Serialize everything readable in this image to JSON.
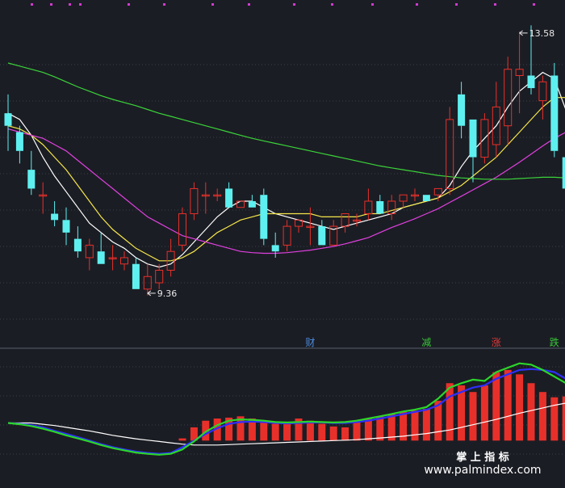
{
  "chart_data": [
    {
      "type": "candlestick",
      "title": "",
      "ylim": [
        8.6,
        13.9
      ],
      "grid": true,
      "candles": [
        [
          12.2,
          12.5,
          11.6,
          12.0
        ],
        [
          11.9,
          12.0,
          11.4,
          11.6
        ],
        [
          11.3,
          11.6,
          10.9,
          11.0
        ],
        [
          10.9,
          11.1,
          10.6,
          10.9
        ],
        [
          10.6,
          10.8,
          10.4,
          10.5
        ],
        [
          10.5,
          10.7,
          10.1,
          10.3
        ],
        [
          10.2,
          10.4,
          9.9,
          10.0
        ],
        [
          9.9,
          10.2,
          9.7,
          10.1
        ],
        [
          10.0,
          10.3,
          9.8,
          9.8
        ],
        [
          9.9,
          10.1,
          9.7,
          9.9
        ],
        [
          9.8,
          10.0,
          9.7,
          9.9
        ],
        [
          9.8,
          9.9,
          9.4,
          9.4
        ],
        [
          9.4,
          9.8,
          9.3,
          9.6
        ],
        [
          9.5,
          9.8,
          9.4,
          9.7
        ],
        [
          9.7,
          10.2,
          9.6,
          10.0
        ],
        [
          10.1,
          10.7,
          10.0,
          10.6
        ],
        [
          10.6,
          11.1,
          10.5,
          11.0
        ],
        [
          10.9,
          11.1,
          10.6,
          10.9
        ],
        [
          10.9,
          11.0,
          10.8,
          10.9
        ],
        [
          11.0,
          11.1,
          10.7,
          10.7
        ],
        [
          10.7,
          10.8,
          10.7,
          10.8
        ],
        [
          10.8,
          10.9,
          10.7,
          10.7
        ],
        [
          10.9,
          11.0,
          10.1,
          10.2
        ],
        [
          10.1,
          10.3,
          9.9,
          10.0
        ],
        [
          10.1,
          10.5,
          10.0,
          10.4
        ],
        [
          10.4,
          10.5,
          10.3,
          10.5
        ],
        [
          10.4,
          10.7,
          10.1,
          10.4
        ],
        [
          10.4,
          10.5,
          10.1,
          10.1
        ],
        [
          10.1,
          10.5,
          10.1,
          10.4
        ],
        [
          10.4,
          10.6,
          10.3,
          10.6
        ],
        [
          10.5,
          10.6,
          10.4,
          10.5
        ],
        [
          10.6,
          11.0,
          10.5,
          10.8
        ],
        [
          10.8,
          10.9,
          10.6,
          10.6
        ],
        [
          10.6,
          10.9,
          10.5,
          10.8
        ],
        [
          10.8,
          10.9,
          10.7,
          10.9
        ],
        [
          10.9,
          11.0,
          10.8,
          10.9
        ],
        [
          10.9,
          10.9,
          10.8,
          10.8
        ],
        [
          10.9,
          11.0,
          10.8,
          11.0
        ],
        [
          11.0,
          12.3,
          10.9,
          12.1
        ],
        [
          12.5,
          12.7,
          11.8,
          12.0
        ],
        [
          12.1,
          12.1,
          11.1,
          11.5
        ],
        [
          11.5,
          12.2,
          11.4,
          12.1
        ],
        [
          11.7,
          12.7,
          11.5,
          12.3
        ],
        [
          12.0,
          13.1,
          11.7,
          12.9
        ],
        [
          12.8,
          13.5,
          12.2,
          12.9
        ],
        [
          12.8,
          13.6,
          12.5,
          12.6
        ],
        [
          12.4,
          12.8,
          12.1,
          12.7
        ],
        [
          12.8,
          13.0,
          11.5,
          11.6
        ],
        [
          11.5,
          11.7,
          10.7,
          11.0
        ],
        [
          10.9,
          11.9,
          10.8,
          11.8
        ]
      ],
      "ma_lines": [
        {
          "color": "#ffffff",
          "values": [
            12.2,
            12.1,
            11.85,
            11.5,
            11.2,
            10.95,
            10.7,
            10.45,
            10.3,
            10.15,
            10.05,
            9.9,
            9.8,
            9.75,
            9.8,
            9.95,
            10.15,
            10.35,
            10.55,
            10.7,
            10.8,
            10.8,
            10.7,
            10.6,
            10.55,
            10.5,
            10.45,
            10.4,
            10.35,
            10.4,
            10.45,
            10.5,
            10.55,
            10.6,
            10.7,
            10.75,
            10.8,
            10.85,
            11.05,
            11.35,
            11.6,
            11.8,
            12.0,
            12.3,
            12.55,
            12.7,
            12.85,
            12.75,
            12.25,
            12.15
          ]
        },
        {
          "color": "#f5e64a",
          "values": [
            12.0,
            11.95,
            11.85,
            11.7,
            11.5,
            11.3,
            11.05,
            10.8,
            10.55,
            10.35,
            10.2,
            10.05,
            9.95,
            9.85,
            9.85,
            9.9,
            10.0,
            10.15,
            10.3,
            10.4,
            10.5,
            10.55,
            10.6,
            10.6,
            10.6,
            10.6,
            10.6,
            10.55,
            10.55,
            10.55,
            10.55,
            10.6,
            10.6,
            10.65,
            10.7,
            10.75,
            10.8,
            10.85,
            10.95,
            11.05,
            11.2,
            11.35,
            11.5,
            11.7,
            11.9,
            12.1,
            12.3,
            12.45,
            12.45,
            12.5
          ]
        },
        {
          "color": "#e040e0",
          "values": [
            11.95,
            11.9,
            11.85,
            11.8,
            11.7,
            11.6,
            11.45,
            11.3,
            11.15,
            11.0,
            10.85,
            10.7,
            10.55,
            10.45,
            10.35,
            10.25,
            10.2,
            10.15,
            10.1,
            10.05,
            10.0,
            9.98,
            9.97,
            9.97,
            9.98,
            10.0,
            10.02,
            10.05,
            10.08,
            10.12,
            10.17,
            10.22,
            10.3,
            10.38,
            10.45,
            10.52,
            10.6,
            10.68,
            10.78,
            10.88,
            10.98,
            11.08,
            11.18,
            11.3,
            11.42,
            11.55,
            11.68,
            11.8,
            11.9,
            11.95
          ]
        },
        {
          "color": "#3ad43a",
          "values": [
            13.0,
            12.95,
            12.9,
            12.85,
            12.78,
            12.7,
            12.62,
            12.55,
            12.48,
            12.42,
            12.37,
            12.32,
            12.26,
            12.2,
            12.15,
            12.1,
            12.05,
            12.0,
            11.95,
            11.9,
            11.85,
            11.8,
            11.76,
            11.72,
            11.68,
            11.64,
            11.6,
            11.56,
            11.52,
            11.48,
            11.44,
            11.4,
            11.36,
            11.33,
            11.3,
            11.27,
            11.24,
            11.21,
            11.19,
            11.17,
            11.16,
            11.15,
            11.15,
            11.15,
            11.16,
            11.17,
            11.18,
            11.18,
            11.17,
            11.15
          ]
        }
      ],
      "annotations": [
        {
          "text": "13.58",
          "x_index": 44,
          "value": 13.58
        },
        {
          "text": "9.36",
          "x_index": 12,
          "value": 9.36
        }
      ],
      "event_tags": [
        {
          "text": "财",
          "x_index": 26,
          "color": "#4d8de0"
        },
        {
          "text": "减",
          "x_index": 36,
          "color": "#39c639"
        },
        {
          "text": "涨",
          "x_index": 42,
          "color": "#e03a3a"
        },
        {
          "text": "跌",
          "x_index": 47,
          "color": "#39c639"
        }
      ]
    },
    {
      "type": "bar",
      "title": "",
      "ylim": [
        -1.0,
        2.0
      ],
      "grid": true,
      "values": [
        0,
        0,
        0,
        0,
        0,
        0,
        0,
        0,
        0,
        0,
        0,
        0,
        0,
        0,
        0,
        0.05,
        0.3,
        0.45,
        0.5,
        0.52,
        0.55,
        0.5,
        0.42,
        0.38,
        0.4,
        0.5,
        0.45,
        0.38,
        0.32,
        0.3,
        0.42,
        0.5,
        0.55,
        0.6,
        0.65,
        0.68,
        0.72,
        0.9,
        1.3,
        1.25,
        1.1,
        1.25,
        1.55,
        1.6,
        1.5,
        1.3,
        1.1,
        0.98,
        1.0,
        1.0
      ],
      "lines": [
        {
          "color": "#ffffff",
          "values": [
            0.4,
            0.4,
            0.4,
            0.37,
            0.34,
            0.3,
            0.26,
            0.22,
            0.17,
            0.12,
            0.08,
            0.04,
            0.01,
            -0.02,
            -0.05,
            -0.08,
            -0.1,
            -0.1,
            -0.1,
            -0.09,
            -0.08,
            -0.07,
            -0.06,
            -0.05,
            -0.04,
            -0.03,
            -0.02,
            -0.01,
            0.0,
            0.01,
            0.02,
            0.04,
            0.06,
            0.08,
            0.1,
            0.13,
            0.16,
            0.2,
            0.24,
            0.3,
            0.36,
            0.42,
            0.48,
            0.55,
            0.62,
            0.68,
            0.74,
            0.8,
            0.85,
            0.9
          ]
        },
        {
          "color": "#2e2eff",
          "values": [
            0.4,
            0.38,
            0.35,
            0.3,
            0.22,
            0.15,
            0.08,
            0.0,
            -0.08,
            -0.15,
            -0.2,
            -0.25,
            -0.28,
            -0.3,
            -0.28,
            -0.15,
            0.0,
            0.15,
            0.28,
            0.38,
            0.42,
            0.43,
            0.42,
            0.4,
            0.39,
            0.4,
            0.41,
            0.41,
            0.4,
            0.4,
            0.42,
            0.45,
            0.5,
            0.55,
            0.6,
            0.65,
            0.7,
            0.8,
            1.0,
            1.1,
            1.2,
            1.25,
            1.4,
            1.5,
            1.6,
            1.62,
            1.6,
            1.55,
            1.4,
            1.3
          ]
        },
        {
          "color": "#2bd62b",
          "values": [
            0.4,
            0.37,
            0.33,
            0.27,
            0.2,
            0.12,
            0.05,
            -0.02,
            -0.1,
            -0.17,
            -0.22,
            -0.27,
            -0.3,
            -0.32,
            -0.3,
            -0.2,
            -0.02,
            0.2,
            0.35,
            0.45,
            0.48,
            0.47,
            0.45,
            0.42,
            0.41,
            0.42,
            0.43,
            0.42,
            0.41,
            0.42,
            0.45,
            0.5,
            0.55,
            0.6,
            0.66,
            0.7,
            0.76,
            0.95,
            1.2,
            1.3,
            1.38,
            1.35,
            1.55,
            1.65,
            1.75,
            1.72,
            1.6,
            1.45,
            1.3,
            1.25
          ]
        }
      ]
    }
  ],
  "watermark": {
    "line1": "掌 上 指 标",
    "line2": "www.palmindex.com"
  },
  "colors": {
    "up": "#e8302a",
    "down": "#5ef0f0",
    "background": "#1b1d24",
    "grid": "#3c3f4a"
  }
}
